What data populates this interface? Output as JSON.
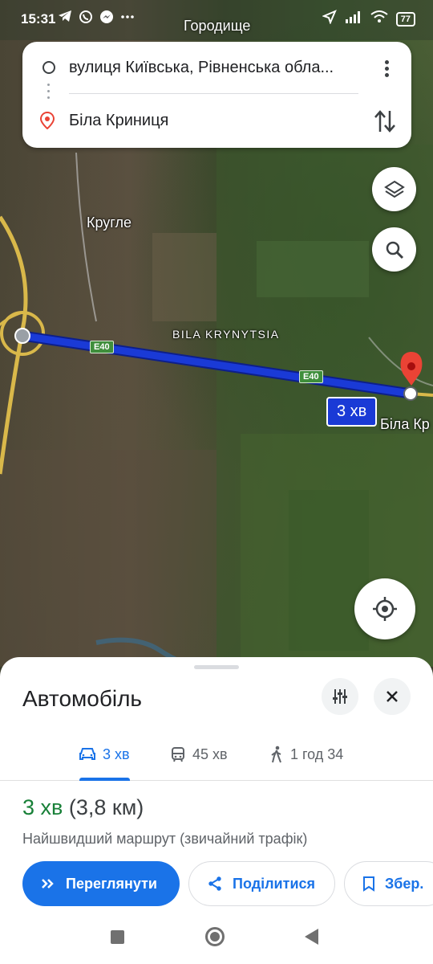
{
  "status_bar": {
    "time": "15:31",
    "left_icons": [
      "telegram-icon",
      "viber-icon",
      "messenger-icon",
      "more-dots"
    ],
    "right_icons": [
      "location-arrow-icon",
      "signal-icon",
      "wifi-icon"
    ],
    "battery": "77"
  },
  "map": {
    "labels": {
      "top": "Городище",
      "village": "Кругле",
      "area": "BILA KRYNYTSIA",
      "destination": "Біла Кр"
    },
    "road_shields": [
      "E40",
      "E40"
    ],
    "eta_bubble": "3 хв",
    "route_color": "#1a3ad6"
  },
  "directions": {
    "origin": "вулиця Київська, Рівненська обла...",
    "destination": "Біла Криниця"
  },
  "sheet": {
    "title": "Автомобіль",
    "modes": [
      {
        "icon": "car-icon",
        "label": "3 хв",
        "active": true
      },
      {
        "icon": "transit-icon",
        "label": "45 хв",
        "active": false
      },
      {
        "icon": "walk-icon",
        "label": "1 год 34",
        "active": false
      }
    ],
    "summary": {
      "eta": "3 хв",
      "distance": "(3,8 км)"
    },
    "description": "Найшвидший маршрут (звичайний трафік)",
    "buttons": {
      "preview": "Переглянути",
      "share": "Поділитися",
      "save": "Збер."
    }
  },
  "colors": {
    "accent": "#1a73e8",
    "eta_green": "#188038",
    "pin_red": "#ea4335"
  }
}
